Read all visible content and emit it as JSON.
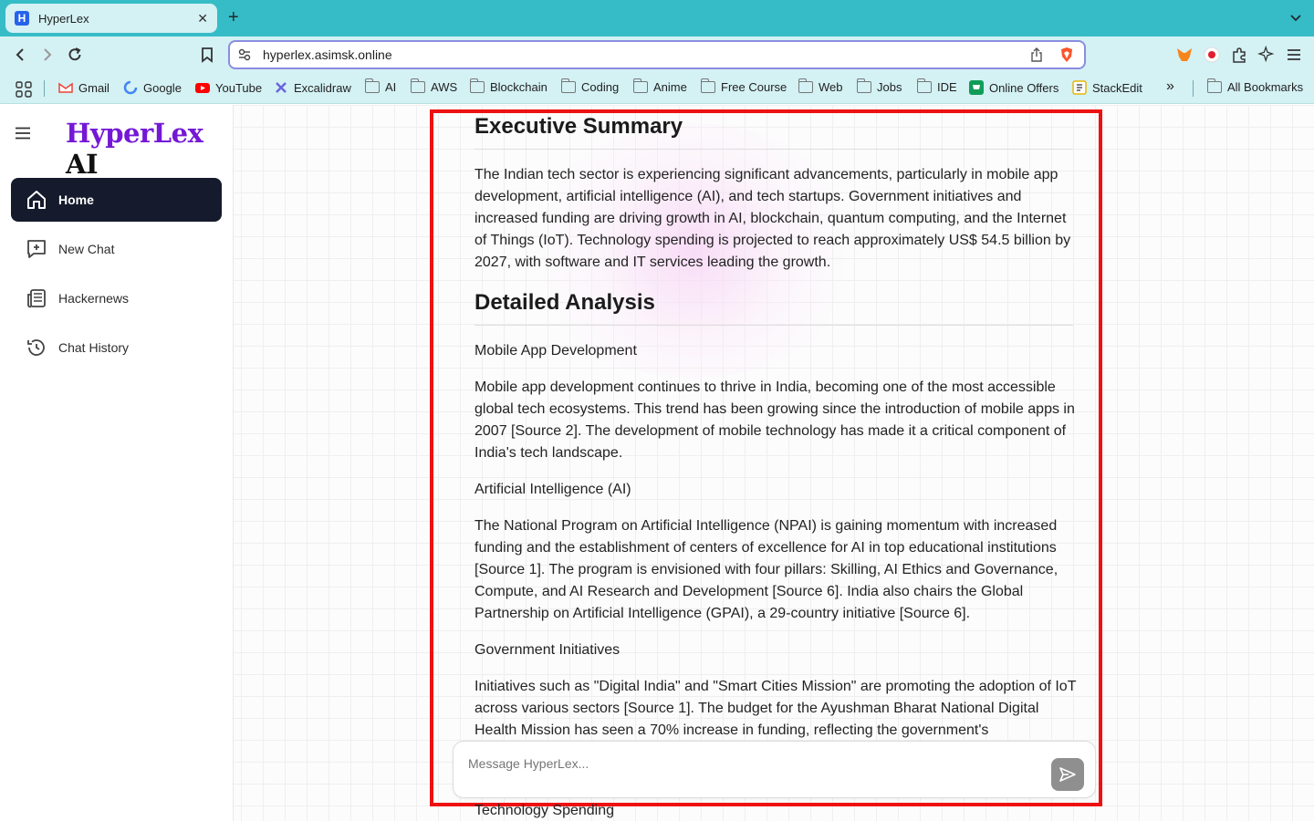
{
  "browser": {
    "tab_title": "HyperLex",
    "url": "hyperlex.asimsk.online",
    "bookmarks": [
      {
        "label": "Gmail",
        "icon": "gmail-icon"
      },
      {
        "label": "Google",
        "icon": "google-icon"
      },
      {
        "label": "YouTube",
        "icon": "youtube-icon"
      },
      {
        "label": "Excalidraw",
        "icon": "excalidraw-icon"
      },
      {
        "label": "AI",
        "icon": "folder-icon"
      },
      {
        "label": "AWS",
        "icon": "folder-icon"
      },
      {
        "label": "Blockchain",
        "icon": "folder-icon"
      },
      {
        "label": "Coding",
        "icon": "folder-icon"
      },
      {
        "label": "Anime",
        "icon": "folder-icon"
      },
      {
        "label": "Free Course",
        "icon": "folder-icon"
      },
      {
        "label": "Web",
        "icon": "folder-icon"
      },
      {
        "label": "Jobs",
        "icon": "folder-icon"
      },
      {
        "label": "IDE",
        "icon": "folder-icon"
      },
      {
        "label": "Online Offers",
        "icon": "cart-icon"
      },
      {
        "label": "StackEdit",
        "icon": "stackedit-icon"
      }
    ],
    "overflow_label": "»",
    "all_bookmarks": "All Bookmarks"
  },
  "app": {
    "logo_brand": "HyperLex",
    "logo_suffix": "AI",
    "nav": [
      {
        "label": "Home",
        "icon": "home-icon",
        "active": true
      },
      {
        "label": "New Chat",
        "icon": "new-chat-icon",
        "active": false
      },
      {
        "label": "Hackernews",
        "icon": "newspaper-icon",
        "active": false
      },
      {
        "label": "Chat History",
        "icon": "history-icon",
        "active": false
      }
    ]
  },
  "report": {
    "executive_heading": "Executive Summary",
    "executive_text": "The Indian tech sector is experiencing significant advancements, particularly in mobile app development, artificial intelligence (AI), and tech startups. Government initiatives and increased funding are driving growth in AI, blockchain, quantum computing, and the Internet of Things (IoT). Technology spending is projected to reach approximately US$ 54.5 billion by 2027, with software and IT services leading the growth.",
    "analysis_heading": "Detailed Analysis",
    "mobile_title": "Mobile App Development",
    "mobile_text": "Mobile app development continues to thrive in India, becoming one of the most accessible global tech ecosystems. This trend has been growing since the introduction of mobile apps in 2007 [Source 2]. The development of mobile technology has made it a critical component of India's tech landscape.",
    "ai_title": "Artificial Intelligence (AI)",
    "ai_text": "The National Program on Artificial Intelligence (NPAI) is gaining momentum with increased funding and the establishment of centers of excellence for AI in top educational institutions [Source 1]. The program is envisioned with four pillars: Skilling, AI Ethics and Governance, Compute, and AI Research and Development [Source 6]. India also chairs the Global Partnership on Artificial Intelligence (GPAI), a 29-country initiative [Source 6].",
    "gov_title": "Government Initiatives",
    "gov_text": "Initiatives such as \"Digital India\" and \"Smart Cities Mission\" are promoting the adoption of IoT across various sectors [Source 1]. The budget for the Ayushman Bharat National Digital Health Mission has seen a 70% increase in funding, reflecting the government's",
    "spending_title": "Technology Spending"
  },
  "composer": {
    "placeholder": "Message HyperLex..."
  },
  "colors": {
    "tab_bar": "#36bcc6",
    "toolbar": "#d4f1f4",
    "brand_purple": "#7418d6",
    "active_nav": "#151b2c",
    "highlight_border": "#ee1111"
  }
}
